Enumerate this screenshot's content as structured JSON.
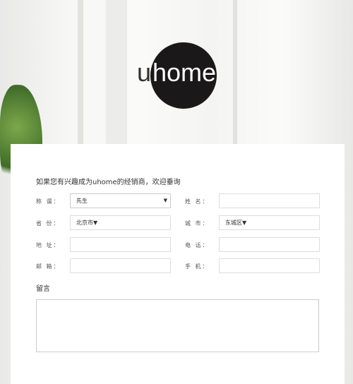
{
  "logo": {
    "text_u": "u",
    "text_home": "home"
  },
  "form": {
    "title": "如果您有兴趣成为uhome的经销商，欢迎垂询",
    "salutation": {
      "label": "称 谓：",
      "value": "先生"
    },
    "name": {
      "label": "姓 名：",
      "value": ""
    },
    "province": {
      "label": "省 份：",
      "value": "北京市"
    },
    "city": {
      "label": "城 市：",
      "value": "东城区"
    },
    "address": {
      "label": "地 址：",
      "value": ""
    },
    "phone": {
      "label": "电 话：",
      "value": ""
    },
    "email": {
      "label": "邮 箱：",
      "value": ""
    },
    "mobile": {
      "label": "手 机：",
      "value": ""
    },
    "message_label": "留言",
    "arrow": "▼"
  }
}
